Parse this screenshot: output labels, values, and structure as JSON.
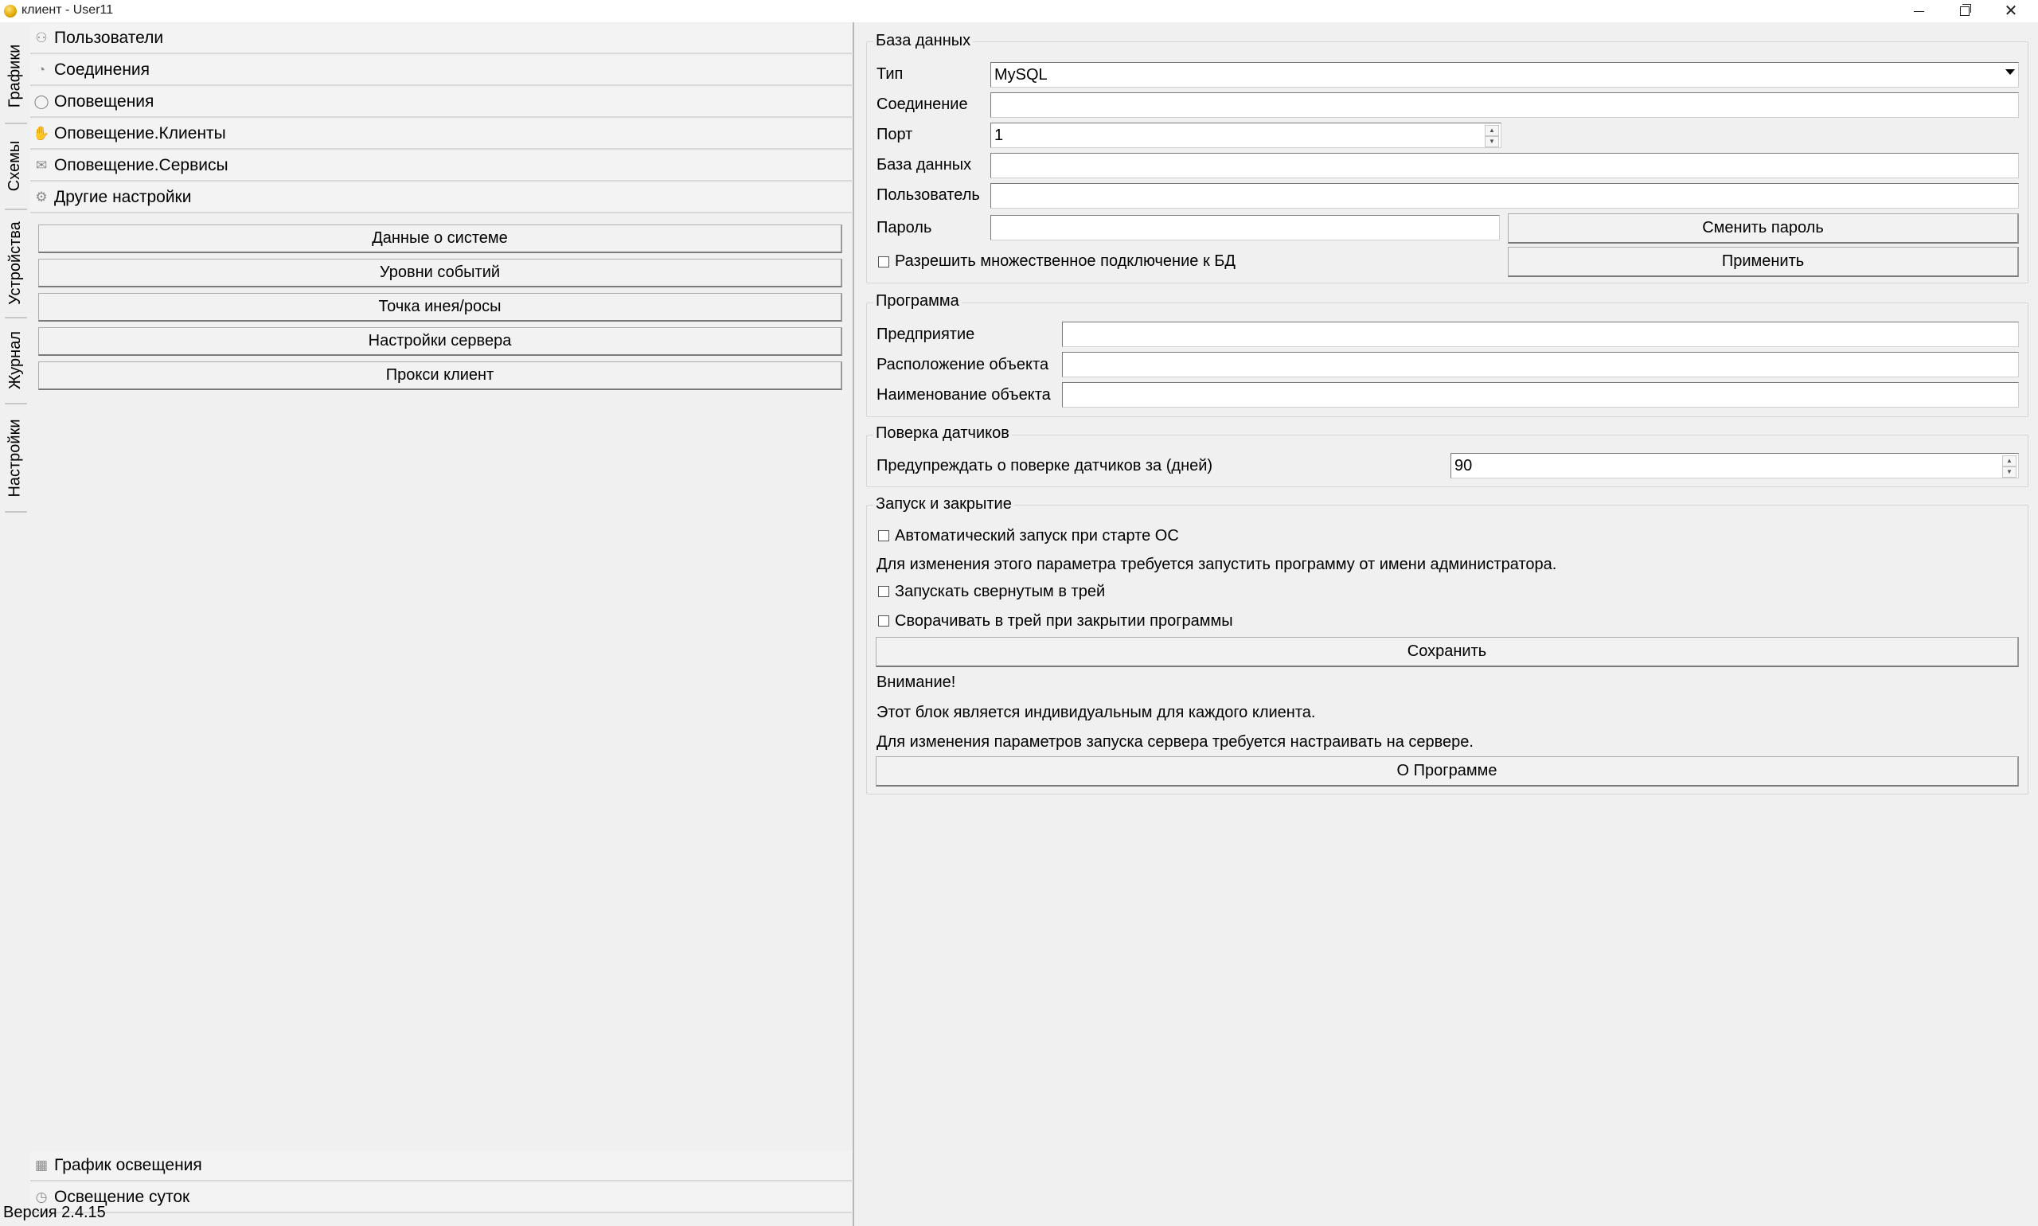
{
  "window": {
    "title": "клиент - User11"
  },
  "vertical_tabs": [
    {
      "label": "Графики"
    },
    {
      "label": "Схемы"
    },
    {
      "label": "Устройства"
    },
    {
      "label": "Журнал"
    },
    {
      "label": "Настройки"
    }
  ],
  "accordion_top": [
    {
      "label": "Пользователи",
      "icon": "users-icon"
    },
    {
      "label": "Соединения",
      "icon": "rss-icon"
    },
    {
      "label": "Оповещения",
      "icon": "speech-bubble-icon"
    },
    {
      "label": "Оповещение.Клиенты",
      "icon": "hand-icon"
    },
    {
      "label": "Оповещение.Сервисы",
      "icon": "envelope-icon"
    },
    {
      "label": "Другие настройки",
      "icon": "gear-icon"
    }
  ],
  "system_buttons": [
    {
      "label": "Данные о системе"
    },
    {
      "label": "Уровни событий"
    },
    {
      "label": "Точка инея/росы"
    },
    {
      "label": "Настройки сервера"
    },
    {
      "label": "Прокси клиент"
    }
  ],
  "accordion_bottom": [
    {
      "label": "График освещения",
      "icon": "calendar-icon"
    },
    {
      "label": "Освещение суток",
      "icon": "clock-icon"
    }
  ],
  "status": {
    "version": "Версия 2.4.15"
  },
  "database": {
    "title": "База данных",
    "type_label": "Тип",
    "type_value": "MySQL",
    "connection_label": "Соединение",
    "connection_value": "",
    "port_label": "Порт",
    "port_value": "1",
    "db_label": "База данных",
    "db_value": "",
    "user_label": "Пользователь",
    "user_value": "",
    "password_label": "Пароль",
    "password_value": "",
    "change_password_button": "Сменить пароль",
    "apply_button": "Применить",
    "multi_connection_label": "Разрешить множественное подключение к БД"
  },
  "program": {
    "title": "Программа",
    "enterprise_label": "Предприятие",
    "enterprise_value": "",
    "location_label": "Расположение объекта",
    "location_value": "",
    "name_label": "Наименование объекта",
    "name_value": ""
  },
  "sensor_check": {
    "title": "Поверка датчиков",
    "warn_label": "Предупреждать о поверке датчиков за (дней)",
    "warn_value": "90"
  },
  "startup": {
    "title": "Запуск и закрытие",
    "autostart_label": "Автоматический запуск при старте ОС",
    "admin_note": "Для изменения этого параметра требуется запустить программу от имени администратора.",
    "start_minimized_label": "Запускать свернутым в трей",
    "minimize_on_close_label": "Сворачивать в трей при закрытии программы",
    "save_button": "Сохранить",
    "attention": "Внимание!",
    "note_individual": "Этот блок является индивидуальным для каждого клиента.",
    "note_server": "Для изменения параметров запуска сервера требуется настраивать на сервере.",
    "about_button": "О Программе"
  }
}
